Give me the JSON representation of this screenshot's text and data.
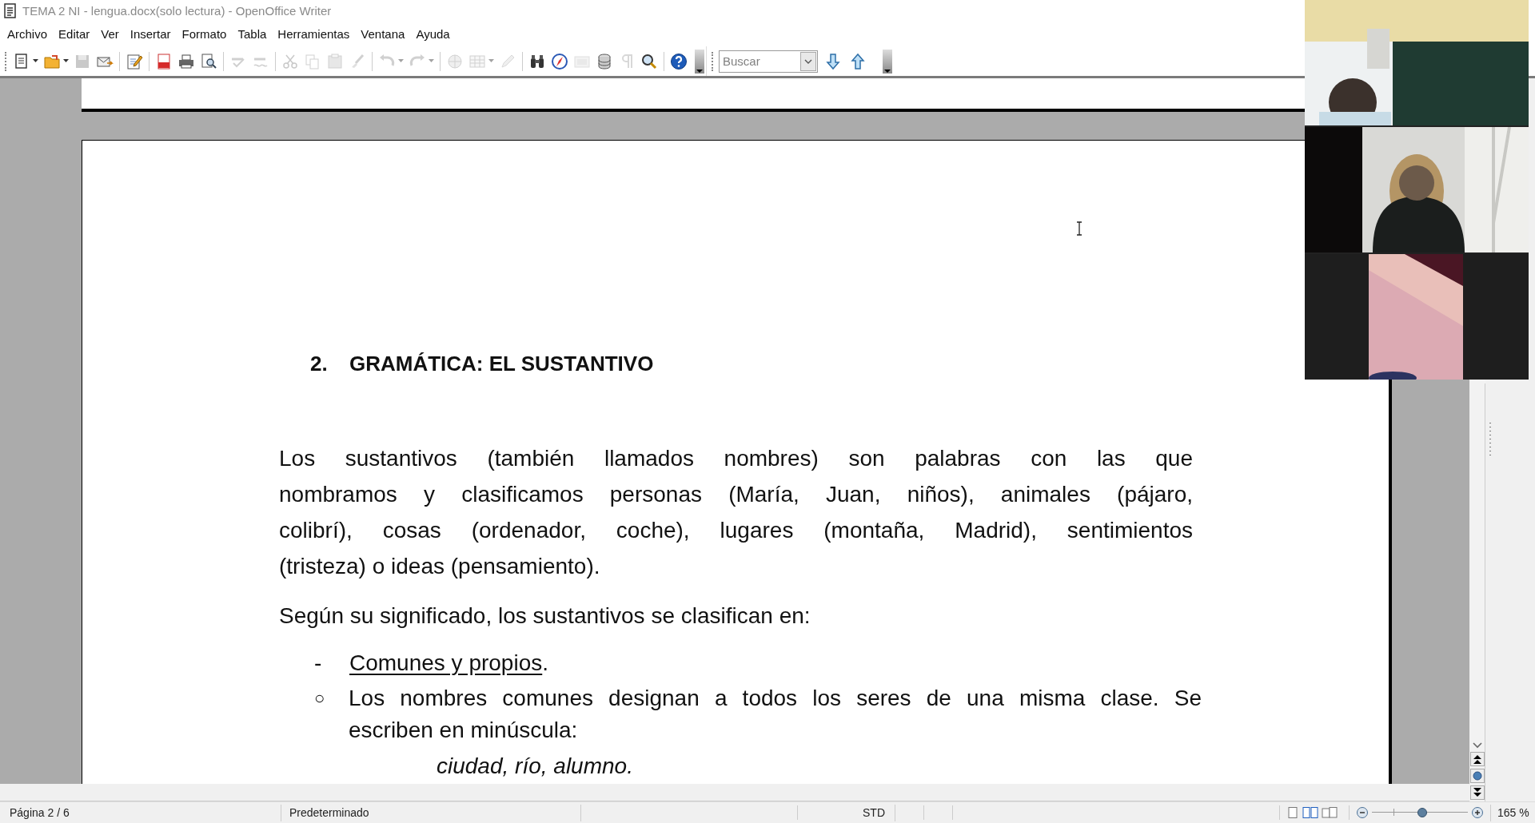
{
  "window": {
    "title": "TEMA 2 NI - lengua.docx(solo lectura) - OpenOffice Writer"
  },
  "menu": [
    "Archivo",
    "Editar",
    "Ver",
    "Insertar",
    "Formato",
    "Tabla",
    "Herramientas",
    "Ventana",
    "Ayuda"
  ],
  "toolbar": {
    "groups": [
      [
        {
          "kind": "new",
          "disabled": false,
          "dropdown": true
        },
        {
          "kind": "open",
          "disabled": false,
          "dropdown": true
        },
        {
          "kind": "save",
          "disabled": true,
          "dropdown": false
        },
        {
          "kind": "email",
          "disabled": false,
          "dropdown": false
        }
      ],
      [
        {
          "kind": "edit",
          "disabled": false,
          "dropdown": false
        }
      ],
      [
        {
          "kind": "pdf",
          "disabled": false,
          "dropdown": false
        },
        {
          "kind": "print",
          "disabled": false,
          "dropdown": false
        },
        {
          "kind": "preview",
          "disabled": false,
          "dropdown": false
        }
      ],
      [
        {
          "kind": "spellcheck",
          "disabled": true,
          "dropdown": false
        },
        {
          "kind": "autospell",
          "disabled": true,
          "dropdown": false
        }
      ],
      [
        {
          "kind": "cut",
          "disabled": true,
          "dropdown": false
        },
        {
          "kind": "copy",
          "disabled": true,
          "dropdown": false
        },
        {
          "kind": "paste",
          "disabled": true,
          "dropdown": false
        },
        {
          "kind": "brush",
          "disabled": true,
          "dropdown": false
        }
      ],
      [
        {
          "kind": "undo",
          "disabled": true,
          "dropdown": true
        },
        {
          "kind": "redo",
          "disabled": true,
          "dropdown": true
        }
      ],
      [
        {
          "kind": "globe",
          "disabled": true,
          "dropdown": false
        },
        {
          "kind": "table",
          "disabled": true,
          "dropdown": true
        },
        {
          "kind": "pencil",
          "disabled": true,
          "dropdown": false
        }
      ],
      [
        {
          "kind": "binoculars",
          "disabled": false,
          "dropdown": false
        },
        {
          "kind": "compass",
          "disabled": false,
          "dropdown": false
        },
        {
          "kind": "gallery",
          "disabled": true,
          "dropdown": false
        },
        {
          "kind": "database",
          "disabled": false,
          "dropdown": false
        },
        {
          "kind": "pilcrow",
          "disabled": true,
          "dropdown": false
        },
        {
          "kind": "zoom",
          "disabled": false,
          "dropdown": false
        }
      ],
      [
        {
          "kind": "help",
          "disabled": false,
          "dropdown": false
        }
      ]
    ]
  },
  "find_toolbar": {
    "placeholder": "Buscar"
  },
  "document": {
    "heading": {
      "number": "2.",
      "text": "GRAMÁTICA: EL SUSTANTIVO"
    },
    "paragraph_lines": [
      "Los sustantivos (también llamados nombres) son palabras con las que",
      "nombramos y clasificamos personas (María, Juan, niños), animales (pájaro,",
      "colibrí), cosas (ordenador, coche), lugares (montaña, Madrid), sentimientos",
      "(tristeza) o ideas (pensamiento)."
    ],
    "intro": "Según su significado, los sustantivos se clasifican en:",
    "list_item": {
      "marker": "-",
      "label": "Comunes y propios",
      "suffix": "."
    },
    "sub_item": {
      "marker": "○",
      "lines": [
        "Los nombres comunes designan a todos los seres de una misma clase. Se",
        "escriben en minúscula:"
      ]
    },
    "example": "ciudad, río, alumno."
  },
  "status_bar": {
    "page": "Página 2 / 6",
    "style": "Predeterminado",
    "mode": "STD",
    "zoom": "165 %",
    "views": [
      {
        "kind": "single",
        "selected": false
      },
      {
        "kind": "multi",
        "selected": true
      },
      {
        "kind": "book",
        "selected": false
      }
    ],
    "zoom_slider": {
      "level": 0.53
    }
  }
}
